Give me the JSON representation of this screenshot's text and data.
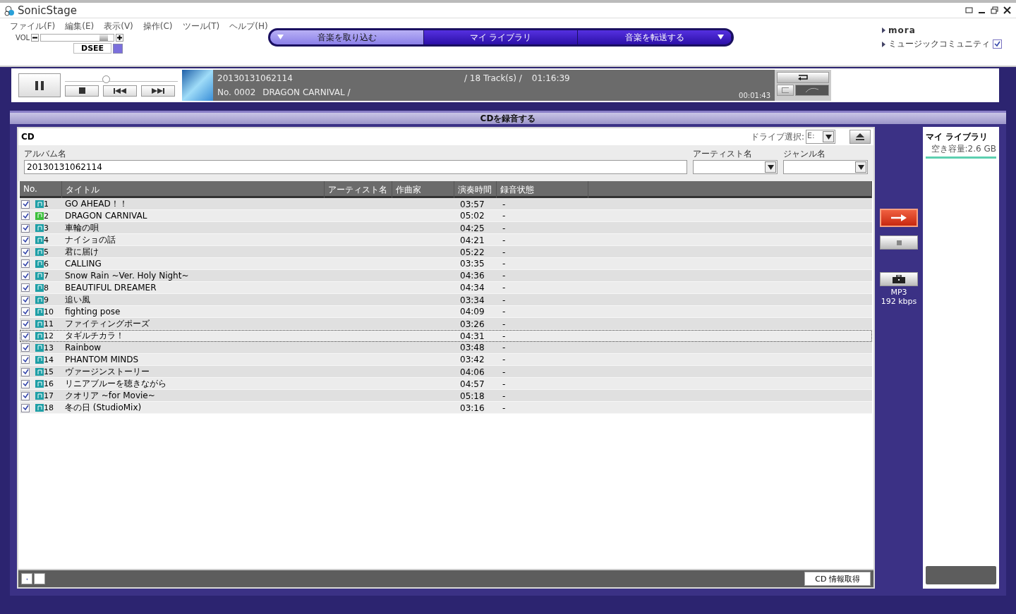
{
  "window": {
    "title": "SonicStage"
  },
  "menu": [
    "ファイル(F)",
    "編集(E)",
    "表示(V)",
    "操作(C)",
    "ツール(T)",
    "ヘルプ(H)"
  ],
  "volume": {
    "label": "VOL",
    "level": 0.92
  },
  "dsee": {
    "label": "DSEE",
    "on": true
  },
  "nav_tabs": [
    {
      "label": "音楽を取り込む",
      "selected": true
    },
    {
      "label": "マイ ライブラリ",
      "selected": false
    },
    {
      "label": "音楽を転送する",
      "selected": false
    }
  ],
  "links": [
    {
      "label": "mora",
      "kind": "logo"
    },
    {
      "label": "ミュージックコミュニティ",
      "kind": "check",
      "checked": true
    }
  ],
  "player": {
    "seek": {
      "level": 0.33
    },
    "album": "20130131062114",
    "tracks": "/ 18 Track(s) /",
    "total": "01:16:39",
    "number": "No. 0002",
    "title": "DRAGON CARNIVAL /",
    "elapsed": "00:01:43"
  },
  "section_title": "CDを録音する",
  "cd": {
    "heading": "CD",
    "drive_label": "ドライブ選択:",
    "drive": "E:",
    "album_label": "アルバム名",
    "album": "20130131062114",
    "artist_label": "アーティスト名",
    "genre_label": "ジャンル名"
  },
  "table": {
    "columns": [
      "No.",
      "タイトル",
      "アーティスト名",
      "作曲家",
      "演奏時間",
      "録音状態"
    ],
    "rows": [
      {
        "no": "1",
        "title": "GO AHEAD！！",
        "time": "03:57",
        "status": "-",
        "checked": true,
        "color": "#1f9fa6",
        "selected": false
      },
      {
        "no": "2",
        "title": "DRAGON CARNIVAL",
        "time": "05:02",
        "status": "-",
        "checked": true,
        "color": "#3cbf3c",
        "selected": false
      },
      {
        "no": "3",
        "title": "車輪の唄",
        "time": "04:25",
        "status": "-",
        "checked": true,
        "color": "#1f9fa6",
        "selected": false
      },
      {
        "no": "4",
        "title": "ナイショの話",
        "time": "04:21",
        "status": "-",
        "checked": true,
        "color": "#1f9fa6",
        "selected": false
      },
      {
        "no": "5",
        "title": "君に届け",
        "time": "05:22",
        "status": "-",
        "checked": true,
        "color": "#1f9fa6",
        "selected": false
      },
      {
        "no": "6",
        "title": "CALLING",
        "time": "03:35",
        "status": "-",
        "checked": true,
        "color": "#1f9fa6",
        "selected": false
      },
      {
        "no": "7",
        "title": "Snow Rain ~Ver. Holy Night~",
        "time": "04:36",
        "status": "-",
        "checked": true,
        "color": "#1f9fa6",
        "selected": false
      },
      {
        "no": "8",
        "title": "BEAUTIFUL DREAMER",
        "time": "04:34",
        "status": "-",
        "checked": true,
        "color": "#1f9fa6",
        "selected": false
      },
      {
        "no": "9",
        "title": "追い風",
        "time": "03:34",
        "status": "-",
        "checked": true,
        "color": "#1f9fa6",
        "selected": false
      },
      {
        "no": "10",
        "title": "fighting pose",
        "time": "04:09",
        "status": "-",
        "checked": true,
        "color": "#1f9fa6",
        "selected": false
      },
      {
        "no": "11",
        "title": "ファイティングポーズ",
        "time": "03:26",
        "status": "-",
        "checked": true,
        "color": "#1f9fa6",
        "selected": false
      },
      {
        "no": "12",
        "title": "タギルチカラ！",
        "time": "04:31",
        "status": "-",
        "checked": true,
        "color": "#1f9fa6",
        "selected": true
      },
      {
        "no": "13",
        "title": "Rainbow",
        "time": "03:48",
        "status": "-",
        "checked": true,
        "color": "#1f9fa6",
        "selected": false
      },
      {
        "no": "14",
        "title": "PHANTOM MINDS",
        "time": "03:42",
        "status": "-",
        "checked": true,
        "color": "#1f9fa6",
        "selected": false
      },
      {
        "no": "15",
        "title": "ヴァージンストーリー",
        "time": "04:06",
        "status": "-",
        "checked": true,
        "color": "#1f9fa6",
        "selected": false
      },
      {
        "no": "16",
        "title": "リニアブルーを聴きながら",
        "time": "04:57",
        "status": "-",
        "checked": true,
        "color": "#1f9fa6",
        "selected": false
      },
      {
        "no": "17",
        "title": "クオリア ~for Movie~",
        "time": "05:18",
        "status": "-",
        "checked": true,
        "color": "#1f9fa6",
        "selected": false
      },
      {
        "no": "18",
        "title": "冬の日 (StudioMix)",
        "time": "03:16",
        "status": "-",
        "checked": true,
        "color": "#1f9fa6",
        "selected": false
      }
    ]
  },
  "fetch_button": "CD 情報取得",
  "format": {
    "codec": "MP3",
    "bitrate": "192 kbps"
  },
  "library": {
    "title": "マイ ライブラリ",
    "free": "空き容量:2.6 GB"
  }
}
